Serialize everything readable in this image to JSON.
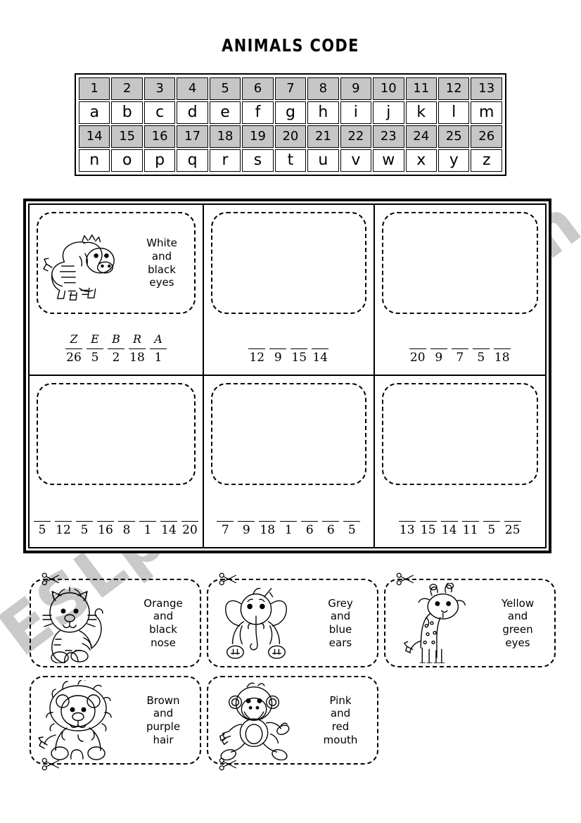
{
  "title": "ANIMALS CODE",
  "watermark": "ESLprintables.com",
  "code_table": {
    "row1_numbers": [
      "1",
      "2",
      "3",
      "4",
      "5",
      "6",
      "7",
      "8",
      "9",
      "10",
      "11",
      "12",
      "13"
    ],
    "row1_letters": [
      "a",
      "b",
      "c",
      "d",
      "e",
      "f",
      "g",
      "h",
      "i",
      "j",
      "k",
      "l",
      "m"
    ],
    "row2_numbers": [
      "14",
      "15",
      "16",
      "17",
      "18",
      "19",
      "20",
      "21",
      "22",
      "23",
      "24",
      "25",
      "26"
    ],
    "row2_letters": [
      "n",
      "o",
      "p",
      "q",
      "r",
      "s",
      "t",
      "u",
      "v",
      "w",
      "x",
      "y",
      "z"
    ]
  },
  "puzzles": [
    {
      "filled": true,
      "icon": "zebra-icon",
      "caption": "White\nand\nblack\neyes",
      "caption_lines": [
        "White",
        "and",
        "black",
        "eyes"
      ],
      "letters": [
        "Z",
        "E",
        "B",
        "R",
        "A"
      ],
      "numbers": [
        "26",
        "5",
        "2",
        "18",
        "1"
      ]
    },
    {
      "filled": false,
      "icon": "empty-dashed-box",
      "caption_lines": [],
      "letters": [
        "",
        "",
        "",
        ""
      ],
      "numbers": [
        "12",
        "9",
        "15",
        "14"
      ]
    },
    {
      "filled": false,
      "icon": "empty-dashed-box",
      "caption_lines": [],
      "letters": [
        "",
        "",
        "",
        "",
        ""
      ],
      "numbers": [
        "20",
        "9",
        "7",
        "5",
        "18"
      ]
    },
    {
      "filled": false,
      "icon": "empty-dashed-box",
      "caption_lines": [],
      "letters": [
        "",
        "",
        "",
        "",
        "",
        "",
        "",
        ""
      ],
      "numbers": [
        "5",
        "12",
        "5",
        "16",
        "8",
        "1",
        "14",
        "20"
      ]
    },
    {
      "filled": false,
      "icon": "empty-dashed-box",
      "caption_lines": [],
      "letters": [
        "",
        "",
        "",
        "",
        "",
        "",
        ""
      ],
      "numbers": [
        "7",
        "9",
        "18",
        "1",
        "6",
        "6",
        "5"
      ]
    },
    {
      "filled": false,
      "icon": "empty-dashed-box",
      "caption_lines": [],
      "letters": [
        "",
        "",
        "",
        "",
        "",
        ""
      ],
      "numbers": [
        "13",
        "15",
        "14",
        "11",
        "5",
        "25"
      ]
    }
  ],
  "cards": [
    {
      "icon": "tiger-icon",
      "caption_lines": [
        "Orange",
        "and",
        "black",
        "nose"
      ],
      "scissors": "top-left"
    },
    {
      "icon": "elephant-icon",
      "caption_lines": [
        "Grey",
        "and",
        "blue",
        "ears"
      ],
      "scissors": "top-left"
    },
    {
      "icon": "giraffe-icon",
      "caption_lines": [
        "Yellow",
        "and",
        "green",
        "eyes"
      ],
      "scissors": "top-left"
    },
    {
      "icon": "lion-icon",
      "caption_lines": [
        "Brown",
        "and",
        "purple",
        "hair"
      ],
      "scissors": "bottom-left"
    },
    {
      "icon": "monkey-icon",
      "caption_lines": [
        "Pink",
        "and",
        "red",
        "mouth"
      ],
      "scissors": "bottom-left"
    }
  ],
  "colors": {
    "table_header_bg": "#c6c6c6",
    "ink": "#000000",
    "watermark": "#c9c9c9",
    "page_bg": "#ffffff"
  }
}
